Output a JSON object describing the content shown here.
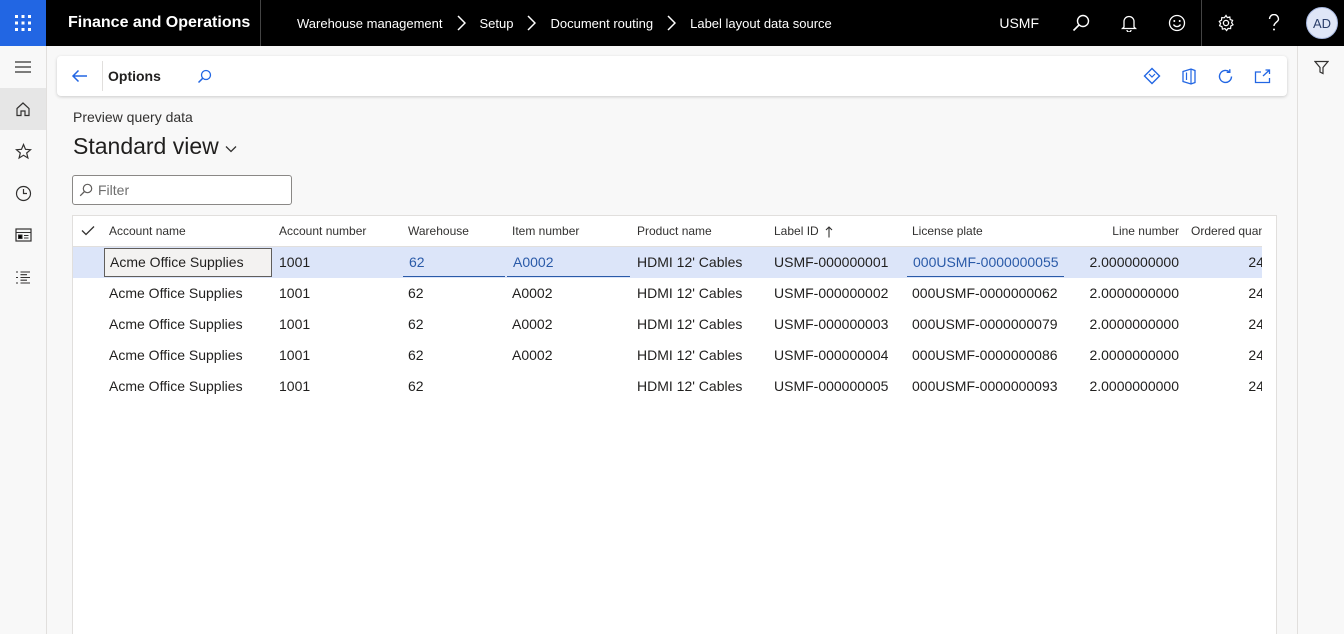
{
  "topbar": {
    "app_title": "Finance and Operations",
    "breadcrumbs": [
      "Warehouse management",
      "Setup",
      "Document routing",
      "Label layout data source"
    ],
    "company": "USMF",
    "user_initials": "AD"
  },
  "actionpane": {
    "options_label": "Options"
  },
  "page": {
    "caption": "Preview query data",
    "view_title": "Standard view"
  },
  "filter": {
    "placeholder": "Filter"
  },
  "grid": {
    "columns": {
      "account_name": "Account name",
      "account_number": "Account number",
      "warehouse": "Warehouse",
      "item_number": "Item number",
      "product_name": "Product name",
      "label_id": "Label ID",
      "license_plate": "License plate",
      "line_number": "Line number",
      "ordered_quantity": "Ordered quantity"
    },
    "rows": [
      {
        "account_name": "Acme Office Supplies",
        "account_number": "1001",
        "warehouse": "62",
        "item_number": "A0002",
        "product_name": "HDMI 12' Cables",
        "label_id": "USMF-000000001",
        "license_plate": "000USMF-0000000055",
        "line_number": "2.0000000000",
        "ordered_quantity": "24"
      },
      {
        "account_name": "Acme Office Supplies",
        "account_number": "1001",
        "warehouse": "62",
        "item_number": "A0002",
        "product_name": "HDMI 12' Cables",
        "label_id": "USMF-000000002",
        "license_plate": "000USMF-0000000062",
        "line_number": "2.0000000000",
        "ordered_quantity": "24"
      },
      {
        "account_name": "Acme Office Supplies",
        "account_number": "1001",
        "warehouse": "62",
        "item_number": "A0002",
        "product_name": "HDMI 12' Cables",
        "label_id": "USMF-000000003",
        "license_plate": "000USMF-0000000079",
        "line_number": "2.0000000000",
        "ordered_quantity": "24"
      },
      {
        "account_name": "Acme Office Supplies",
        "account_number": "1001",
        "warehouse": "62",
        "item_number": "A0002",
        "product_name": "HDMI 12' Cables",
        "label_id": "USMF-000000004",
        "license_plate": "000USMF-0000000086",
        "line_number": "2.0000000000",
        "ordered_quantity": "24"
      },
      {
        "account_name": "Acme Office Supplies",
        "account_number": "1001",
        "warehouse": "62",
        "item_number": "",
        "product_name": "HDMI 12' Cables",
        "label_id": "USMF-000000005",
        "license_plate": "000USMF-0000000093",
        "line_number": "2.0000000000",
        "ordered_quantity": "24"
      }
    ]
  },
  "icons": {
    "waffle": "app-launcher-icon",
    "search": "search-icon",
    "bell": "notification-icon",
    "smiley": "feedback-icon",
    "settings": "gear-icon",
    "help": "help-icon",
    "back": "back-arrow-icon",
    "filter": "funnel-icon"
  },
  "colors": {
    "accent": "#2266e3",
    "selected_row": "#dce5f9",
    "link": "#2a5aa8"
  }
}
